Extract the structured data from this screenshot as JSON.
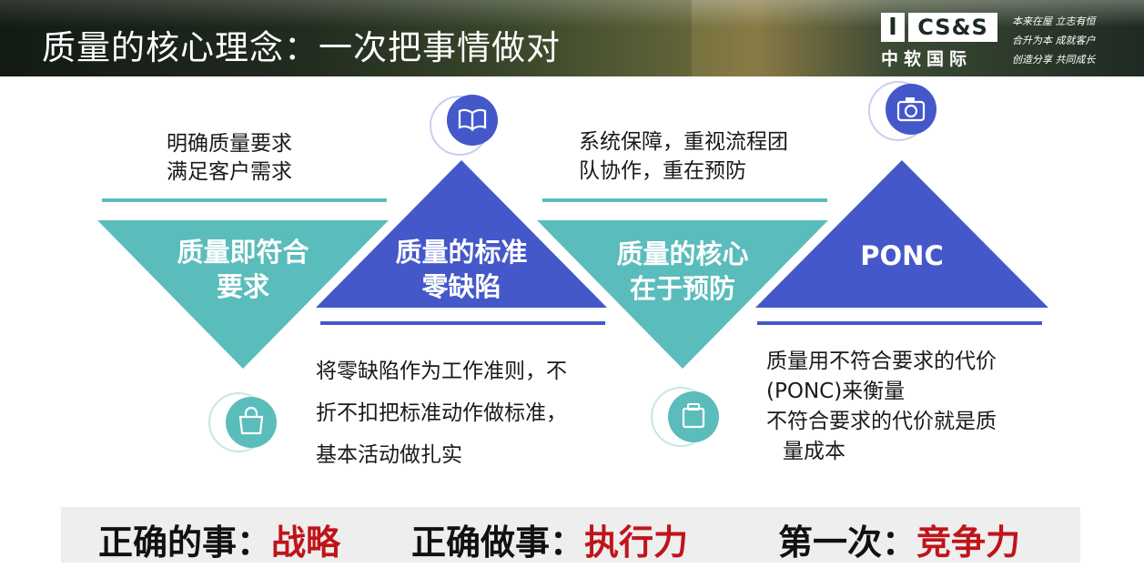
{
  "header": {
    "title": "质量的核心理念：一次把事情做对",
    "logo": {
      "mark": "I",
      "en": "CS&S",
      "cn": "中软国际"
    },
    "slogan_lines": [
      "本来在屋 立志有恒",
      "合升为本 成就客户",
      "创造分享 共同成长"
    ]
  },
  "diagram": {
    "stages": [
      {
        "label_line1": "质量即符合",
        "label_line2": "要求",
        "color": "#5bbcbc",
        "orientation": "down",
        "icon": "shopping-bag-icon",
        "note_lines": [
          "明确质量要求",
          "满足客户需求"
        ]
      },
      {
        "label_line1": "质量的标准",
        "label_line2": "零缺陷",
        "color": "#4458c9",
        "orientation": "up",
        "icon": "book-icon",
        "note_lines": [
          "将零缺陷作为工作准则，不",
          "折不扣把标准动作做标准，",
          "基本活动做扎实"
        ]
      },
      {
        "label_line1": "质量的核心",
        "label_line2": "在于预防",
        "color": "#5bbcbc",
        "orientation": "down",
        "icon": "clipboard-icon",
        "note_lines": [
          "系统保障，重视流程团",
          "队协作，重在预防"
        ]
      },
      {
        "label_line1": "PONC",
        "label_line2": "",
        "color": "#4458c9",
        "orientation": "up",
        "icon": "camera-icon",
        "note_lines": [
          "质量用不符合要求的代价",
          "(PONC)来衡量",
          "不符合要求的代价就是质",
          "量成本"
        ]
      }
    ]
  },
  "bottom": {
    "items": [
      {
        "prefix": "正确的事：",
        "highlight": "战略"
      },
      {
        "prefix": "正确做事：",
        "highlight": "执行力"
      },
      {
        "prefix": "第一次：",
        "highlight": "竞争力"
      }
    ],
    "highlight_color": "#c0141a"
  }
}
